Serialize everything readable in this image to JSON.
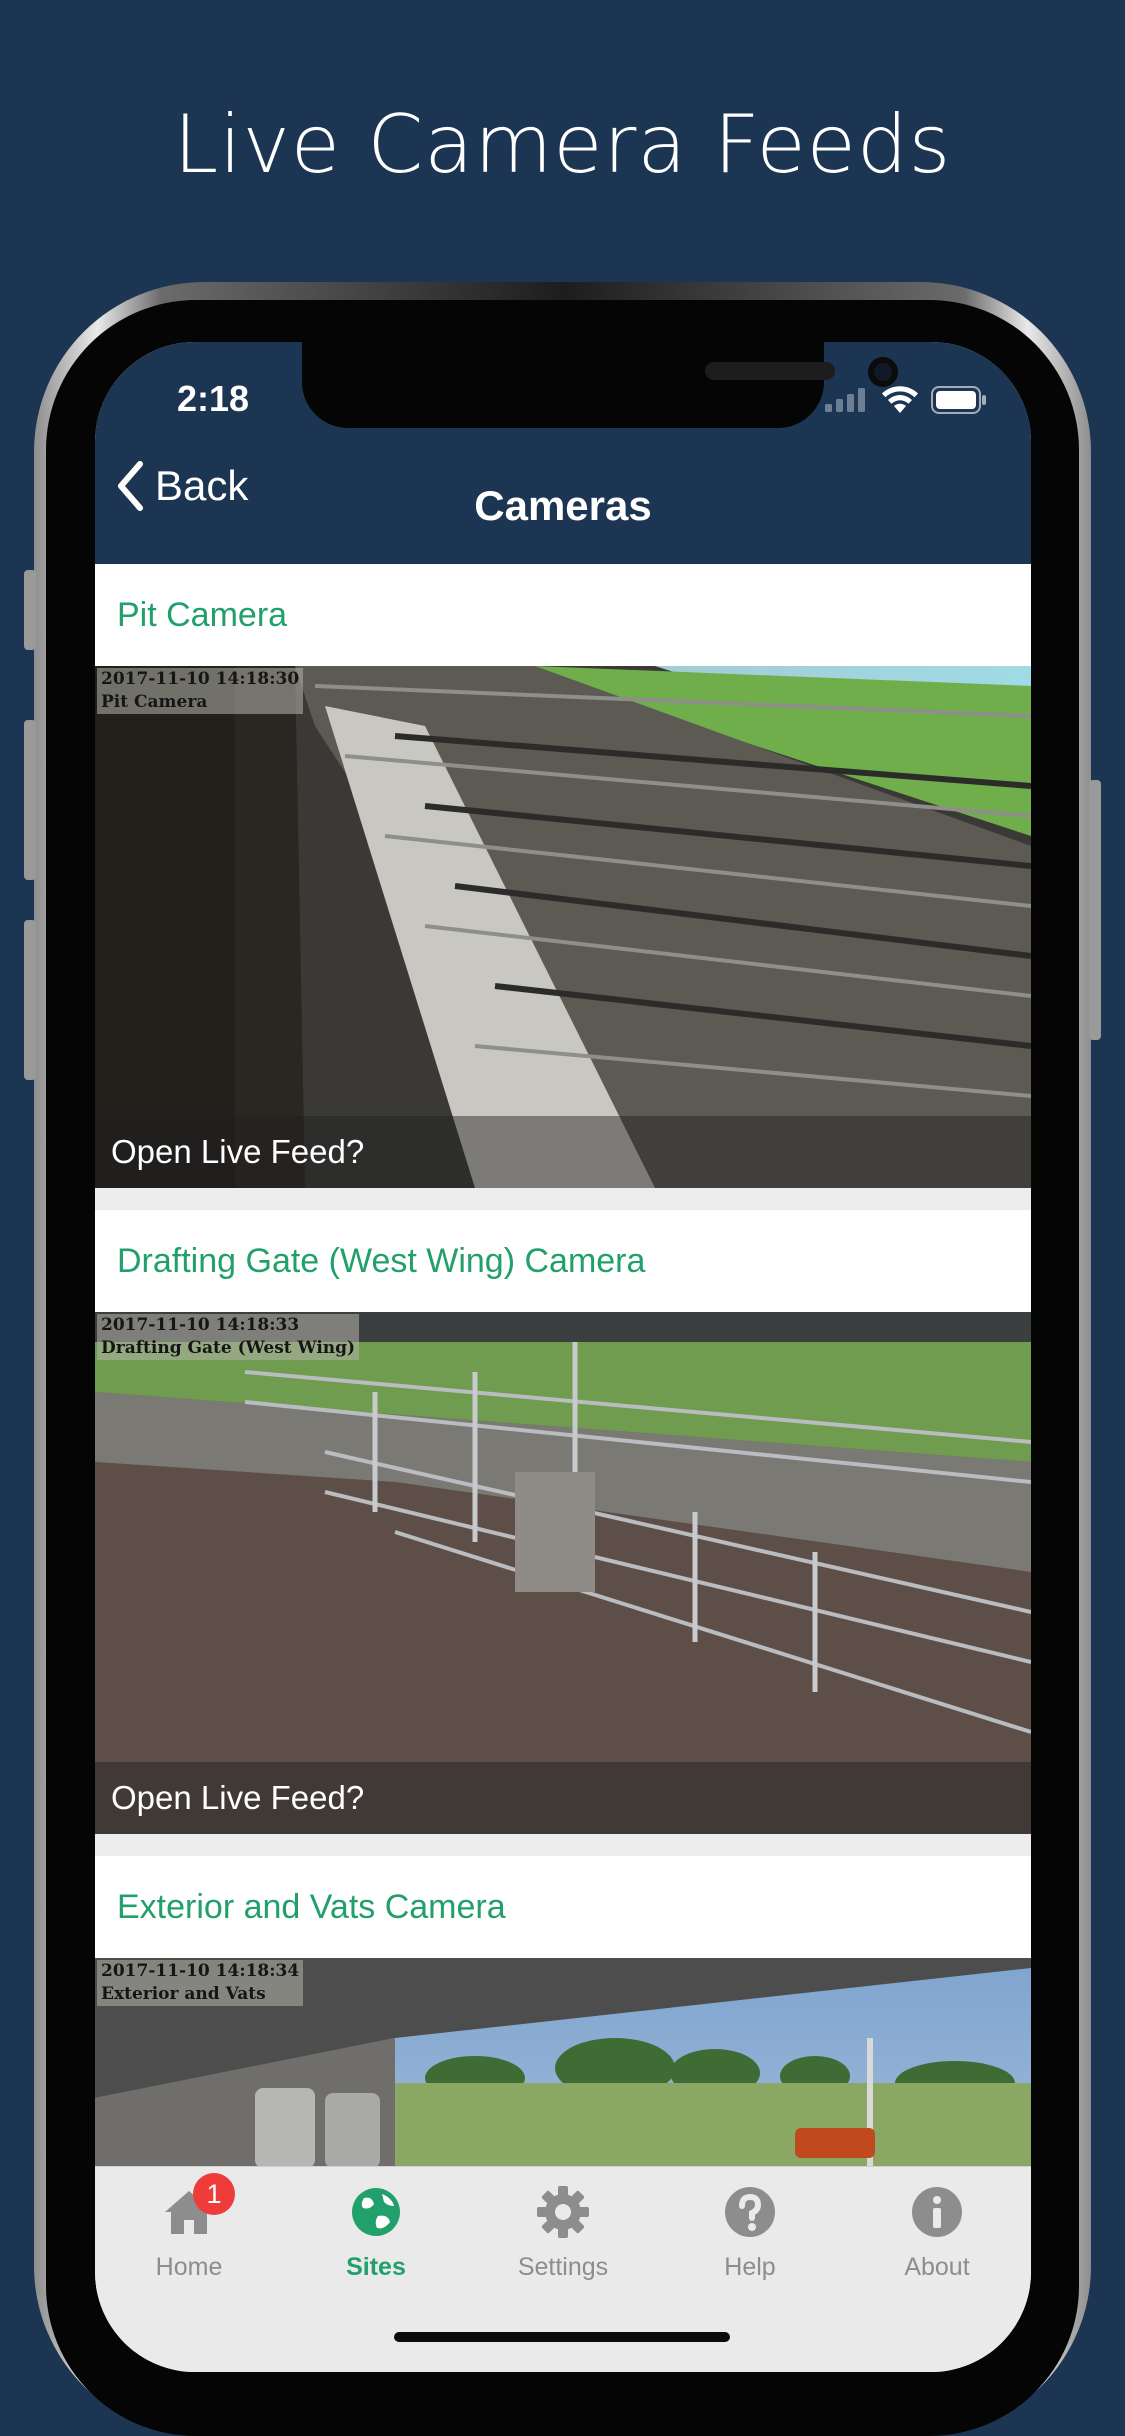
{
  "headline": "Live Camera Feeds",
  "status_bar": {
    "time": "2:18"
  },
  "navbar": {
    "back_label": "Back",
    "title": "Cameras"
  },
  "cameras": [
    {
      "title": "Pit Camera",
      "timestamp": "2017-11-10 14:18:30",
      "overlay_name": "Pit Camera",
      "action": "Open Live Feed?"
    },
    {
      "title": "Drafting Gate (West Wing) Camera",
      "timestamp": "2017-11-10 14:18:33",
      "overlay_name": "Drafting Gate (West Wing)",
      "action": "Open Live Feed?"
    },
    {
      "title": "Exterior and Vats Camera",
      "timestamp": "2017-11-10 14:18:34",
      "overlay_name": "Exterior and Vats",
      "action": ""
    }
  ],
  "tabs": [
    {
      "label": "Home",
      "icon": "home-icon",
      "badge": "1"
    },
    {
      "label": "Sites",
      "icon": "globe-icon",
      "active": true
    },
    {
      "label": "Settings",
      "icon": "gear-icon"
    },
    {
      "label": "Help",
      "icon": "question-icon"
    },
    {
      "label": "About",
      "icon": "info-icon"
    }
  ],
  "colors": {
    "background": "#1b3553",
    "accent": "#22a06b",
    "badge": "#f03b3b"
  }
}
